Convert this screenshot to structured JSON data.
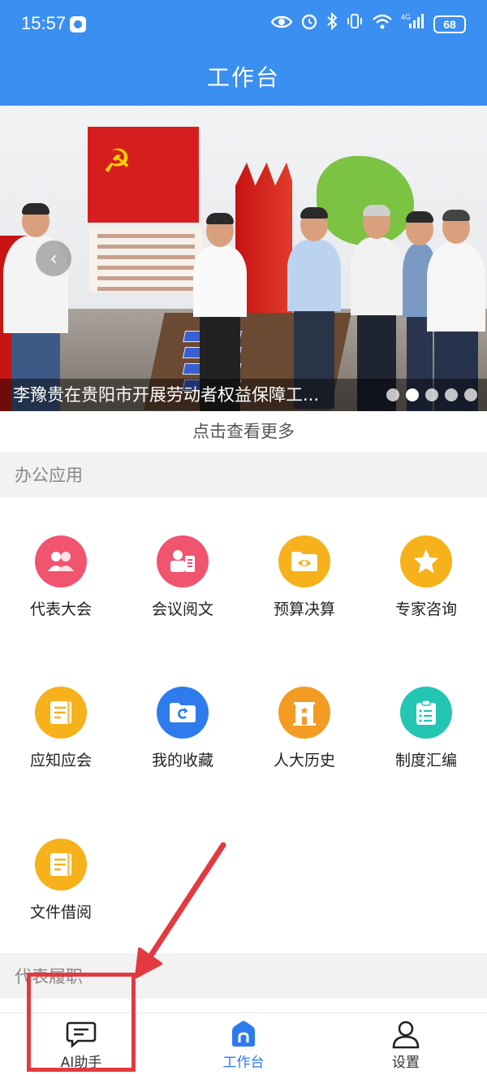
{
  "status_bar": {
    "time": "15:57",
    "battery": "68",
    "network": "4G"
  },
  "header": {
    "title": "工作台"
  },
  "banner": {
    "caption": "李豫贵在贵阳市开展劳动者权益保障工...",
    "slide_count": 5,
    "active_slide": 2
  },
  "more_link": "点击查看更多",
  "sections": {
    "office_apps": "办公应用",
    "duties": "代表履职"
  },
  "apps": [
    {
      "label": "代表大会",
      "icon": "people-icon",
      "color": "#f0546e"
    },
    {
      "label": "会议阅文",
      "icon": "meeting-doc-icon",
      "color": "#f0546e"
    },
    {
      "label": "预算决算",
      "icon": "folder-eye-icon",
      "color": "#f6b11b"
    },
    {
      "label": "专家咨询",
      "icon": "star-icon",
      "color": "#f6b11b"
    },
    {
      "label": "应知应会",
      "icon": "notebook-icon",
      "color": "#f6b11b"
    },
    {
      "label": "我的收藏",
      "icon": "favorites-folder-icon",
      "color": "#2f7bed"
    },
    {
      "label": "人大历史",
      "icon": "building-icon",
      "color": "#f39b23"
    },
    {
      "label": "制度汇编",
      "icon": "clipboard-list-icon",
      "color": "#22c6b3"
    },
    {
      "label": "文件借阅",
      "icon": "notebook-icon",
      "color": "#f6b11b"
    }
  ],
  "tabbar": [
    {
      "label": "AI助手",
      "icon": "chat-icon",
      "active": false
    },
    {
      "label": "工作台",
      "icon": "home-icon",
      "active": true
    },
    {
      "label": "设置",
      "icon": "user-icon",
      "active": false
    }
  ],
  "annotation": {
    "color": "#e23a40"
  }
}
